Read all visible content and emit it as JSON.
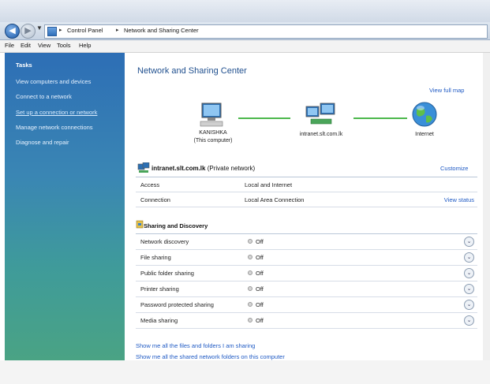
{
  "address": {
    "crumbs": [
      "Control Panel",
      "Network and Sharing Center"
    ]
  },
  "menu": [
    "File",
    "Edit",
    "View",
    "Tools",
    "Help"
  ],
  "sidebar": {
    "heading": "Tasks",
    "items": [
      {
        "label": "View computers and devices"
      },
      {
        "label": "Connect to a network"
      },
      {
        "label": "Set up a connection or network"
      },
      {
        "label": "Manage network connections"
      },
      {
        "label": "Diagnose and repair"
      }
    ]
  },
  "main": {
    "title": "Network and Sharing Center",
    "view_full_map": "View full map",
    "map": {
      "computer_name": "KANISHKA",
      "computer_sub": "(This computer)",
      "network_name": "intranet.slt.com.lk",
      "internet": "Internet"
    },
    "network": {
      "name": "intranet.slt.com.lk",
      "type": "(Private network)",
      "customize": "Customize",
      "rows": [
        {
          "label": "Access",
          "value": "Local and Internet",
          "action": ""
        },
        {
          "label": "Connection",
          "value": "Local Area Connection",
          "action": "View status"
        }
      ]
    },
    "sharing": {
      "title": "Sharing and Discovery",
      "rows": [
        {
          "label": "Network discovery",
          "value": "Off"
        },
        {
          "label": "File sharing",
          "value": "Off"
        },
        {
          "label": "Public folder sharing",
          "value": "Off"
        },
        {
          "label": "Printer sharing",
          "value": "Off"
        },
        {
          "label": "Password protected sharing",
          "value": "Off"
        },
        {
          "label": "Media sharing",
          "value": "Off"
        }
      ]
    },
    "links": [
      "Show me all the files and folders I am sharing",
      "Show me all the shared network folders on this computer"
    ]
  },
  "colors": {
    "sidebar_top": "#2d6eb5",
    "sidebar_bottom": "#4aa384",
    "link": "#1f5ac4",
    "title": "#1f4f8e",
    "connector": "#4cb84c"
  }
}
